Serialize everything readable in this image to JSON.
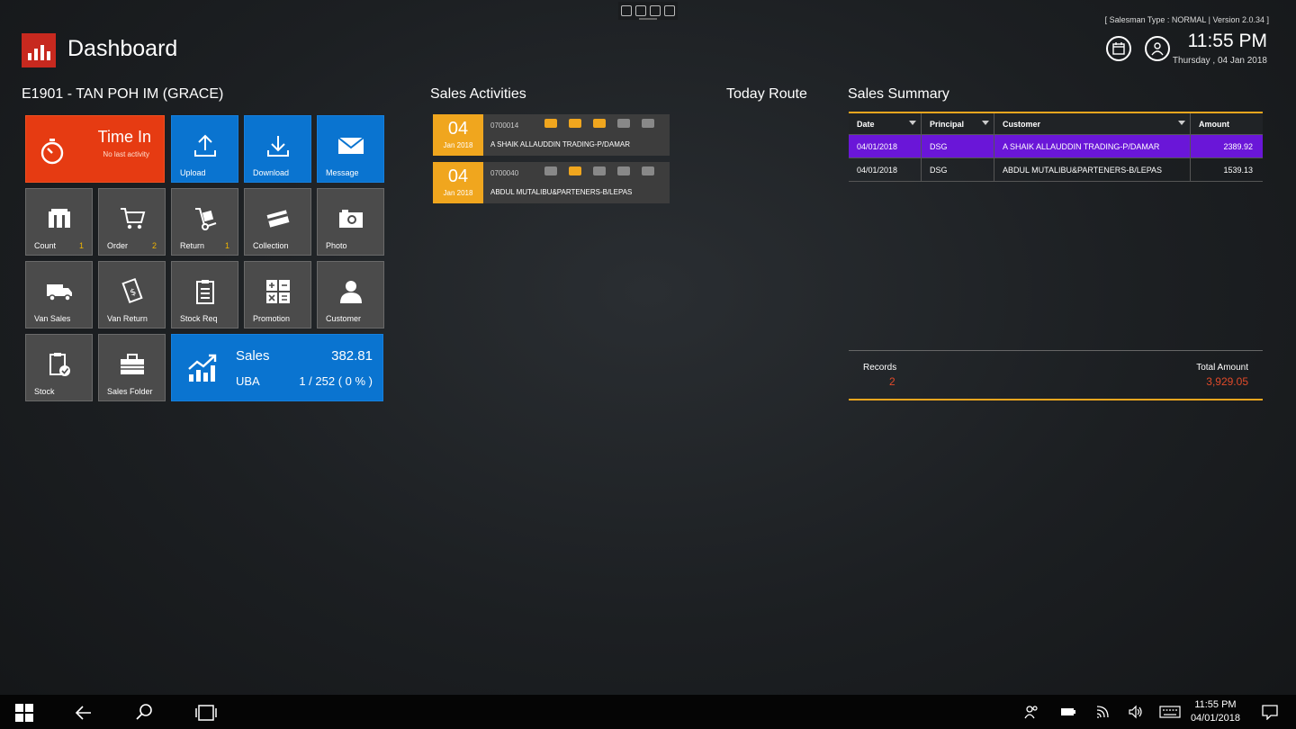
{
  "header": {
    "title": "Dashboard",
    "meta": "[  Salesman Type : NORMAL  |  Version 2.0.34  ]",
    "time": "11:55 PM",
    "date": "Thursday , 04 Jan 2018"
  },
  "user": "E1901 - TAN POH IM (GRACE)",
  "sections": {
    "activities": "Sales Activities",
    "route": "Today Route",
    "summary": "Sales Summary"
  },
  "tiles": {
    "timein": {
      "title": "Time In",
      "sub": "No last activity"
    },
    "upload": "Upload",
    "download": "Download",
    "message": "Message",
    "count": {
      "label": "Count",
      "badge": "1"
    },
    "order": {
      "label": "Order",
      "badge": "2"
    },
    "return": {
      "label": "Return",
      "badge": "1"
    },
    "collection": "Collection",
    "photo": "Photo",
    "vansales": "Van Sales",
    "vanreturn": "Van Return",
    "stockreq": "Stock Req",
    "promotion": "Promotion",
    "customer": "Customer",
    "stock": "Stock",
    "salesfolder": "Sales Folder",
    "sales": {
      "label": "Sales",
      "value": "382.81",
      "uba_label": "UBA",
      "uba_value": "1 / 252 ( 0 % )"
    }
  },
  "activities": [
    {
      "day": "04",
      "month": "Jan 2018",
      "code": "0700014",
      "customer": "A SHAIK ALLAUDDIN TRADING-P/DAMAR"
    },
    {
      "day": "04",
      "month": "Jan 2018",
      "code": "0700040",
      "customer": "ABDUL MUTALIBU&PARTENERS-B/LEPAS"
    }
  ],
  "summary": {
    "headers": [
      "Date",
      "Principal",
      "Customer",
      "Amount"
    ],
    "rows": [
      [
        "04/01/2018",
        "DSG",
        "A SHAIK ALLAUDDIN TRADING-P/DAMAR",
        "2389.92"
      ],
      [
        "04/01/2018",
        "DSG",
        "ABDUL MUTALIBU&PARTENERS-B/LEPAS",
        "1539.13"
      ]
    ],
    "records_label": "Records",
    "records_value": "2",
    "total_label": "Total Amount",
    "total_value": "3,929.05"
  },
  "taskbar": {
    "time": "11:55 PM",
    "date": "04/01/2018"
  },
  "colors": {
    "accent": "#f0a61e",
    "tile_blue": "#0a74d0",
    "tile_red": "#e63b12",
    "selected_row": "#6a16d8",
    "total_value": "#e04a2a"
  }
}
